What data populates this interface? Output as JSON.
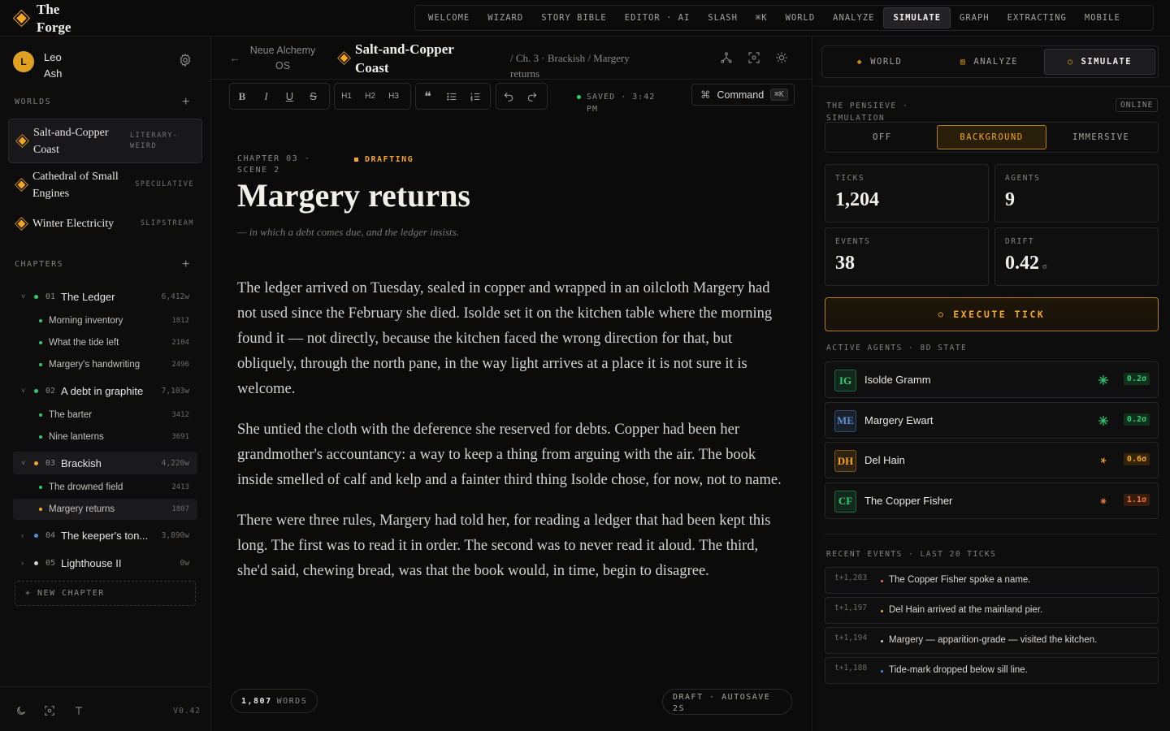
{
  "app": {
    "name": "The Forge"
  },
  "nav": {
    "items": [
      "WELCOME",
      "WIZARD",
      "STORY BIBLE",
      "EDITOR · AI",
      "SLASH",
      "⌘K",
      "WORLD",
      "ANALYZE",
      "SIMULATE",
      "GRAPH",
      "EXTRACTING",
      "MOBILE"
    ],
    "active": "SIMULATE"
  },
  "user": {
    "initial": "L",
    "name": "Leo Ash"
  },
  "sidebar": {
    "worlds_label": "WORLDS",
    "worlds": [
      {
        "name": "Salt-and-Copper Coast",
        "tag": "LITERARY-WEIRD",
        "active": true
      },
      {
        "name": "Cathedral of Small Engines",
        "tag": "SPECULATIVE",
        "active": false
      },
      {
        "name": "Winter Electricity",
        "tag": "SLIPSTREAM",
        "active": false
      }
    ],
    "chapters_label": "CHAPTERS",
    "chapters": [
      {
        "num": "01",
        "title": "The Ledger",
        "words": "6,412w",
        "caret": "˅",
        "dot": "#2ecc71",
        "scenes": [
          {
            "title": "Morning inventory",
            "words": "1812",
            "dot": "#2ecc71"
          },
          {
            "title": "What the tide left",
            "words": "2104",
            "dot": "#2ecc71"
          },
          {
            "title": "Margery's handwriting",
            "words": "2496",
            "dot": "#2ecc71"
          }
        ]
      },
      {
        "num": "02",
        "title": "A debt in graphite",
        "words": "7,103w",
        "caret": "˅",
        "dot": "#2ecc71",
        "scenes": [
          {
            "title": "The barter",
            "words": "3412",
            "dot": "#2ecc71"
          },
          {
            "title": "Nine lanterns",
            "words": "3691",
            "dot": "#2ecc71"
          }
        ]
      },
      {
        "num": "03",
        "title": "Brackish",
        "words": "4,220w",
        "caret": "˅",
        "dot": "#f5a623",
        "active": true,
        "scenes": [
          {
            "title": "The drowned field",
            "words": "2413",
            "dot": "#2ecc71"
          },
          {
            "title": "Margery returns",
            "words": "1807",
            "dot": "#f5a623",
            "active": true
          }
        ]
      },
      {
        "num": "04",
        "title": "The keeper's ton...",
        "words": "3,890w",
        "caret": "›",
        "dot": "#4a90e2",
        "scenes": []
      },
      {
        "num": "05",
        "title": "Lighthouse II",
        "words": "0w",
        "caret": "›",
        "dot": "#cfcfcf",
        "scenes": []
      }
    ],
    "new_chapter": "+ NEW CHAPTER",
    "version": "V0.42"
  },
  "editor": {
    "os": "Neue Alchemy OS",
    "world": "Salt-and-Copper Coast",
    "path": "/ Ch. 3 · Brackish / Margery returns",
    "saved": "SAVED · 3:42 PM",
    "command_label": "Command",
    "command_key": "⌘K",
    "chapter_label": "CHAPTER 03 · SCENE 2",
    "status": "DRAFTING",
    "title": "Margery returns",
    "subtitle": "— in which a debt comes due, and the ledger insists.",
    "paragraphs": [
      "The ledger arrived on Tuesday, sealed in copper and wrapped in an oilcloth Margery had not used since the February she died. Isolde set it on the kitchen table where the morning found it — not directly, because the kitchen faced the wrong direction for that, but obliquely, through the north pane, in the way light arrives at a place it is not sure it is welcome.",
      "She untied the cloth with the deference she reserved for debts. Copper had been her grandmother's accountancy: a way to keep a thing from arguing with the air. The book inside smelled of calf and kelp and a fainter third thing Isolde chose, for now, not to name.",
      "There were three rules, Margery had told her, for reading a ledger that had been kept this long. The first was to read it in order. The second was to never read it aloud. The third, she'd said, chewing bread, was that the book would, in time, begin to disagree."
    ],
    "word_count": "1,807",
    "words_label": "WORDS",
    "autosave": "DRAFT · AUTOSAVE 2S",
    "toolbar": {
      "h1": "H1",
      "h2": "H2",
      "h3": "H3"
    }
  },
  "simulate": {
    "tabs": [
      {
        "label": "WORLD",
        "icon": "diamond-icon"
      },
      {
        "label": "ANALYZE",
        "icon": "grid-icon"
      },
      {
        "label": "SIMULATE",
        "icon": "circle-icon",
        "active": true
      }
    ],
    "label": "THE PENSIEVE · SIMULATION",
    "status": "ONLINE",
    "modes": [
      "OFF",
      "BACKGROUND",
      "IMMERSIVE"
    ],
    "active_mode": "BACKGROUND",
    "stats": [
      {
        "label": "TICKS",
        "value": "1,204",
        "unit": ""
      },
      {
        "label": "AGENTS",
        "value": "9",
        "unit": ""
      },
      {
        "label": "EVENTS",
        "value": "38",
        "unit": ""
      },
      {
        "label": "DRIFT",
        "value": "0.42",
        "unit": "σ"
      }
    ],
    "execute": "EXECUTE TICK",
    "agents_label": "ACTIVE AGENTS · 8D STATE",
    "agents": [
      {
        "initials": "IG",
        "name": "Isolde Gramm",
        "drift": "0.2σ",
        "color": "#2ecc71",
        "level": "low"
      },
      {
        "initials": "ME",
        "name": "Margery Ewart",
        "drift": "0.2σ",
        "color": "#5b8fd9",
        "level": "low"
      },
      {
        "initials": "DH",
        "name": "Del Hain",
        "drift": "0.6σ",
        "color": "#f5a623",
        "level": "mid"
      },
      {
        "initials": "CF",
        "name": "The Copper Fisher",
        "drift": "1.1σ",
        "color": "#2ecc71",
        "level": "high"
      }
    ],
    "events_label": "RECENT EVENTS · LAST 20 TICKS",
    "events": [
      {
        "tick": "t+1,203",
        "text": "The Copper Fisher spoke a name.",
        "dot": "#e8753a"
      },
      {
        "tick": "t+1,197",
        "text": "Del Hain arrived at the mainland pier.",
        "dot": "#f5a623"
      },
      {
        "tick": "t+1,194",
        "text": "Margery — apparition-grade — visited the kitchen.",
        "dot": "#cfcfcf"
      },
      {
        "tick": "t+1,188",
        "text": "Tide-mark dropped below sill line.",
        "dot": "#4a90e2"
      }
    ]
  }
}
